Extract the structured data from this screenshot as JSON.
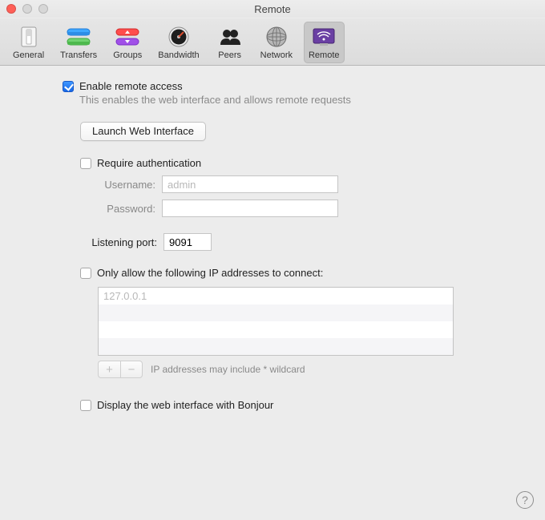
{
  "window": {
    "title": "Remote"
  },
  "tabs": [
    {
      "label": "General"
    },
    {
      "label": "Transfers"
    },
    {
      "label": "Groups"
    },
    {
      "label": "Bandwidth"
    },
    {
      "label": "Peers"
    },
    {
      "label": "Network"
    },
    {
      "label": "Remote"
    }
  ],
  "activeTab": 6,
  "enable": {
    "label": "Enable remote access",
    "checked": true,
    "sub": "This enables the web interface and allows remote requests"
  },
  "launchButton": "Launch Web Interface",
  "auth": {
    "label": "Require authentication",
    "checked": false,
    "usernameLabel": "Username:",
    "username": "admin",
    "passwordLabel": "Password:",
    "password": ""
  },
  "port": {
    "label": "Listening port:",
    "value": "9091"
  },
  "ipfilter": {
    "label": "Only allow the following IP addresses to connect:",
    "checked": false,
    "addresses": [
      "127.0.0.1"
    ],
    "footnote": "IP addresses may include * wildcard"
  },
  "bonjour": {
    "label": "Display the web interface with Bonjour",
    "checked": false
  },
  "buttons": {
    "plus": "+",
    "minus": "−"
  },
  "help": "?"
}
